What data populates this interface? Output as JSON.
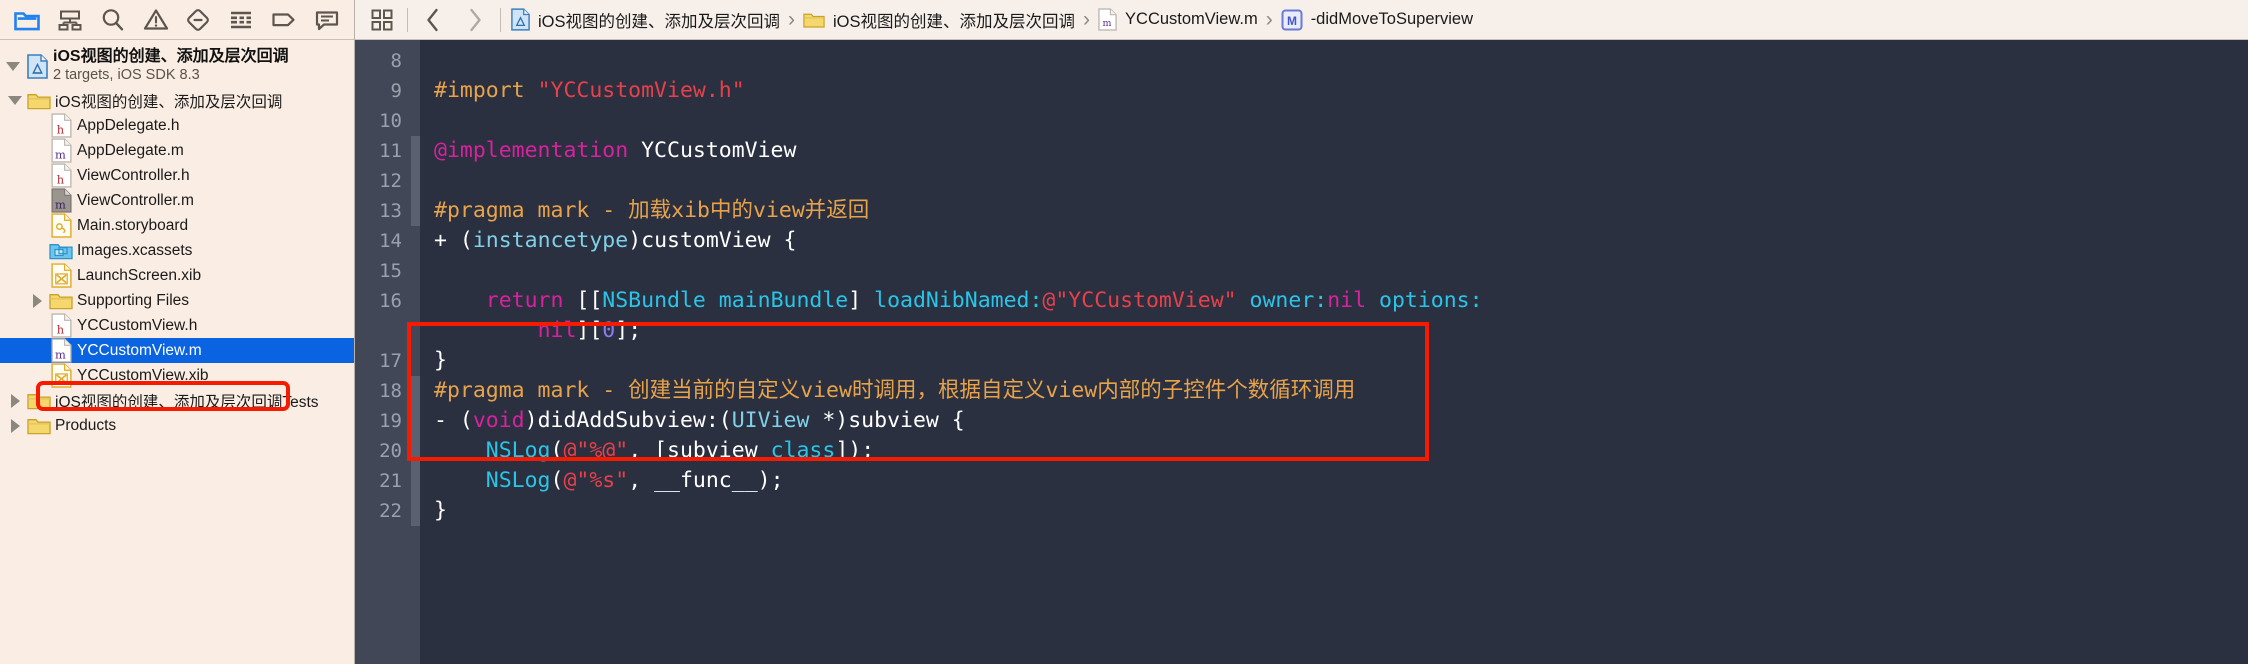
{
  "navigator": {
    "toolbar_icons": [
      {
        "name": "folder-icon",
        "label": "Project navigator",
        "active": true
      },
      {
        "name": "hierarchy-icon",
        "label": "Symbol navigator",
        "active": false
      },
      {
        "name": "search-icon",
        "label": "Find navigator",
        "active": false
      },
      {
        "name": "warning-triangle-icon",
        "label": "Issue navigator",
        "active": false
      },
      {
        "name": "test-diamond-icon",
        "label": "Test navigator",
        "active": false
      },
      {
        "name": "debug-list-icon",
        "label": "Debug navigator",
        "active": false
      },
      {
        "name": "breakpoint-tag-icon",
        "label": "Breakpoint navigator",
        "active": false
      },
      {
        "name": "report-comment-icon",
        "label": "Report navigator",
        "active": false
      }
    ],
    "project": {
      "title": "iOS视图的创建、添加及层次回调",
      "subtitle": "2 targets, iOS SDK 8.3",
      "icon": "xcode-project-icon",
      "expanded": true
    },
    "items": [
      {
        "label": "iOS视图的创建、添加及层次回调",
        "icon": "folder-yellow-icon",
        "indent": 1,
        "disclosure": "open",
        "selected": false
      },
      {
        "label": "AppDelegate.h",
        "icon": "header-file-icon",
        "indent": 2,
        "disclosure": "none",
        "selected": false
      },
      {
        "label": "AppDelegate.m",
        "icon": "m-file-icon",
        "indent": 2,
        "disclosure": "none",
        "selected": false
      },
      {
        "label": "ViewController.h",
        "icon": "header-file-icon",
        "indent": 2,
        "disclosure": "none",
        "selected": false
      },
      {
        "label": "ViewController.m",
        "icon": "m-file-gray-icon",
        "indent": 2,
        "disclosure": "none",
        "selected": false
      },
      {
        "label": "Main.storyboard",
        "icon": "storyboard-file-icon",
        "indent": 2,
        "disclosure": "none",
        "selected": false
      },
      {
        "label": "Images.xcassets",
        "icon": "xcassets-icon",
        "indent": 2,
        "disclosure": "none",
        "selected": false
      },
      {
        "label": "LaunchScreen.xib",
        "icon": "xib-file-icon",
        "indent": 2,
        "disclosure": "none",
        "selected": false
      },
      {
        "label": "Supporting Files",
        "icon": "folder-yellow-icon",
        "indent": 2,
        "disclosure": "closed",
        "selected": false
      },
      {
        "label": "YCCustomView.h",
        "icon": "header-file-icon",
        "indent": 2,
        "disclosure": "none",
        "selected": false
      },
      {
        "label": "YCCustomView.m",
        "icon": "m-file-icon",
        "indent": 2,
        "disclosure": "none",
        "selected": true
      },
      {
        "label": "YCCustomView.xib",
        "icon": "xib-file-icon",
        "indent": 2,
        "disclosure": "none",
        "selected": false
      },
      {
        "label": "iOS视图的创建、添加及层次回调Tests",
        "icon": "folder-yellow-icon",
        "indent": 1,
        "disclosure": "closed",
        "selected": false
      },
      {
        "label": "Products",
        "icon": "folder-yellow-icon",
        "indent": 1,
        "disclosure": "closed",
        "selected": false
      }
    ]
  },
  "jumpbar": {
    "related_items_icon": "related-items-icon",
    "back_icon": "chevron-left-icon",
    "forward_icon": "chevron-right-icon",
    "crumbs": [
      {
        "label": "iOS视图的创建、添加及层次回调",
        "icon": "xcode-project-icon"
      },
      {
        "label": "iOS视图的创建、添加及层次回调",
        "icon": "folder-yellow-icon"
      },
      {
        "label": "YCCustomView.m",
        "icon": "m-file-icon"
      },
      {
        "label": "-didMoveToSuperview",
        "icon": "method-m-icon"
      }
    ],
    "separator": "›"
  },
  "editor": {
    "first_line_number": 8,
    "line_numbers": [
      8,
      9,
      10,
      11,
      12,
      13,
      14,
      15,
      16,
      "",
      17,
      18,
      19,
      20,
      21,
      22
    ],
    "lines": [
      {
        "n": 8,
        "tokens": []
      },
      {
        "n": 9,
        "tokens": [
          {
            "t": "#import ",
            "c": "pre"
          },
          {
            "t": "\"YCCustomView.h\"",
            "c": "str"
          }
        ]
      },
      {
        "n": 10,
        "tokens": []
      },
      {
        "n": 11,
        "tokens": [
          {
            "t": "@implementation",
            "c": "kw"
          },
          {
            "t": " YCCustomView",
            "c": "plain"
          }
        ]
      },
      {
        "n": 12,
        "tokens": []
      },
      {
        "n": 13,
        "tokens": [
          {
            "t": "#pragma mark - ",
            "c": "pre"
          },
          {
            "t": "加载xib中的view并返回",
            "c": "pre"
          }
        ]
      },
      {
        "n": 14,
        "tokens": [
          {
            "t": "+ (",
            "c": "plain"
          },
          {
            "t": "instancetype",
            "c": "type"
          },
          {
            "t": ")customView {",
            "c": "plain"
          }
        ]
      },
      {
        "n": 15,
        "tokens": []
      },
      {
        "n": 16,
        "tokens": [
          {
            "t": "    ",
            "c": "plain"
          },
          {
            "t": "return",
            "c": "kw"
          },
          {
            "t": " [[",
            "c": "plain"
          },
          {
            "t": "NSBundle mainBundle",
            "c": "msg"
          },
          {
            "t": "] ",
            "c": "plain"
          },
          {
            "t": "loadNibNamed:",
            "c": "msg"
          },
          {
            "t": "@\"YCCustomView\"",
            "c": "str"
          },
          {
            "t": " ",
            "c": "plain"
          },
          {
            "t": "owner:",
            "c": "msg"
          },
          {
            "t": "nil",
            "c": "kw"
          },
          {
            "t": " ",
            "c": "plain"
          },
          {
            "t": "options:",
            "c": "msg"
          }
        ]
      },
      {
        "n": "",
        "tokens": [
          {
            "t": "        ",
            "c": "plain"
          },
          {
            "t": "nil",
            "c": "kw"
          },
          {
            "t": "][",
            "c": "plain"
          },
          {
            "t": "0",
            "c": "num"
          },
          {
            "t": "];",
            "c": "plain"
          }
        ]
      },
      {
        "n": 17,
        "tokens": [
          {
            "t": "}",
            "c": "plain"
          }
        ]
      },
      {
        "n": 18,
        "tokens": [
          {
            "t": "#pragma mark - ",
            "c": "pre"
          },
          {
            "t": "创建当前的自定义view时调用，根据自定义view内部的子控件个数循环调用",
            "c": "pre"
          }
        ]
      },
      {
        "n": 19,
        "tokens": [
          {
            "t": "- (",
            "c": "plain"
          },
          {
            "t": "void",
            "c": "kw"
          },
          {
            "t": ")didAddSubview:(",
            "c": "plain"
          },
          {
            "t": "UIView",
            "c": "type"
          },
          {
            "t": " *)subview {",
            "c": "plain"
          }
        ]
      },
      {
        "n": 20,
        "tokens": [
          {
            "t": "    ",
            "c": "plain"
          },
          {
            "t": "NSLog",
            "c": "msg"
          },
          {
            "t": "(",
            "c": "plain"
          },
          {
            "t": "@\"%@\"",
            "c": "str"
          },
          {
            "t": ", [subview ",
            "c": "plain"
          },
          {
            "t": "class",
            "c": "msg"
          },
          {
            "t": "]);",
            "c": "plain"
          }
        ]
      },
      {
        "n": 21,
        "tokens": [
          {
            "t": "    ",
            "c": "plain"
          },
          {
            "t": "NSLog",
            "c": "msg"
          },
          {
            "t": "(",
            "c": "plain"
          },
          {
            "t": "@\"%s\"",
            "c": "str"
          },
          {
            "t": ", __func__);",
            "c": "plain"
          }
        ]
      },
      {
        "n": 22,
        "tokens": [
          {
            "t": "}",
            "c": "plain"
          }
        ]
      }
    ]
  },
  "colors": {
    "selection_blue": "#0a63e0",
    "annotation_red": "#f61b00",
    "navigator_bg": "#FAEDE3",
    "editor_bg": "#2b3040",
    "gutter_bg": "#414756"
  }
}
